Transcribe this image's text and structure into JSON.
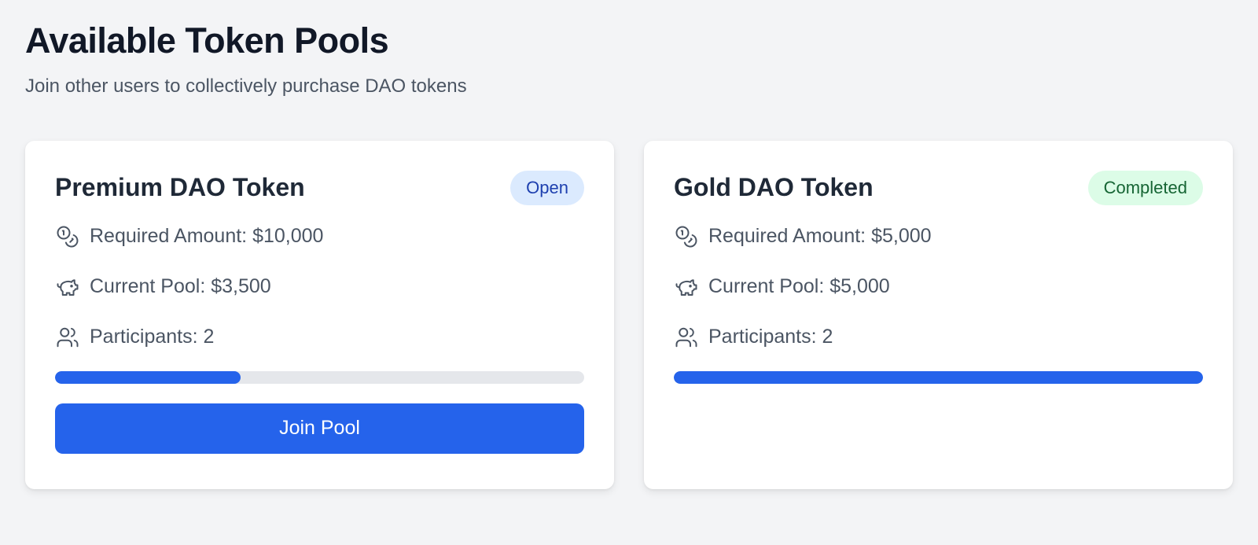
{
  "header": {
    "title": "Available Token Pools",
    "subtitle": "Join other users to collectively purchase DAO tokens"
  },
  "pools": [
    {
      "name": "Premium DAO Token",
      "status": "Open",
      "required": "Required Amount: $10,000",
      "current": "Current Pool: $3,500",
      "participants": "Participants: 2",
      "progress_percent": 35,
      "button_label": "Join Pool"
    },
    {
      "name": "Gold DAO Token",
      "status": "Completed",
      "required": "Required Amount: $5,000",
      "current": "Current Pool: $5,000",
      "participants": "Participants: 2",
      "progress_percent": 100
    }
  ],
  "icons": {
    "required": "coins-icon",
    "current": "piggy-bank-icon",
    "participants": "users-icon"
  },
  "colors": {
    "accent": "#2563eb",
    "open_badge_bg": "#dbeafe",
    "open_badge_text": "#1e40af",
    "completed_badge_bg": "#dcfce7",
    "completed_badge_text": "#166534"
  }
}
